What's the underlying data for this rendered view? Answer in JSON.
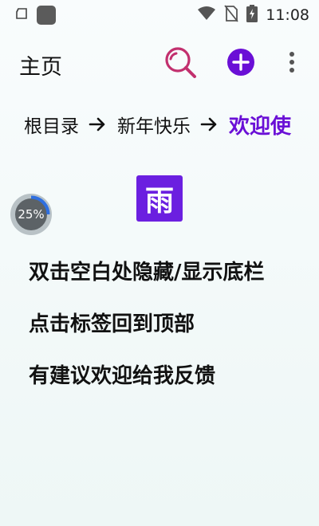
{
  "status_bar": {
    "time": "11:08",
    "icons": [
      "screenshot-icon",
      "app-icon",
      "wifi-icon",
      "no-sim-icon",
      "battery-charging-icon"
    ]
  },
  "header": {
    "title": "主页",
    "search_icon": "search-icon",
    "add_icon": "add-icon",
    "more_icon": "more-vert-icon",
    "colors": {
      "search": "#c2306e",
      "add": "#6a0fd6"
    }
  },
  "breadcrumb": {
    "items": [
      "根目录",
      "新年快乐"
    ],
    "current": "欢迎使",
    "separator_icon": "arrow-right-icon"
  },
  "logo": {
    "char": "雨",
    "color": "#6b1fe0"
  },
  "progress": {
    "label": "25%",
    "value": 0.25
  },
  "tips": [
    "双击空白处隐藏/显示底栏",
    "点击标签回到顶部",
    "有建议欢迎给我反馈"
  ]
}
